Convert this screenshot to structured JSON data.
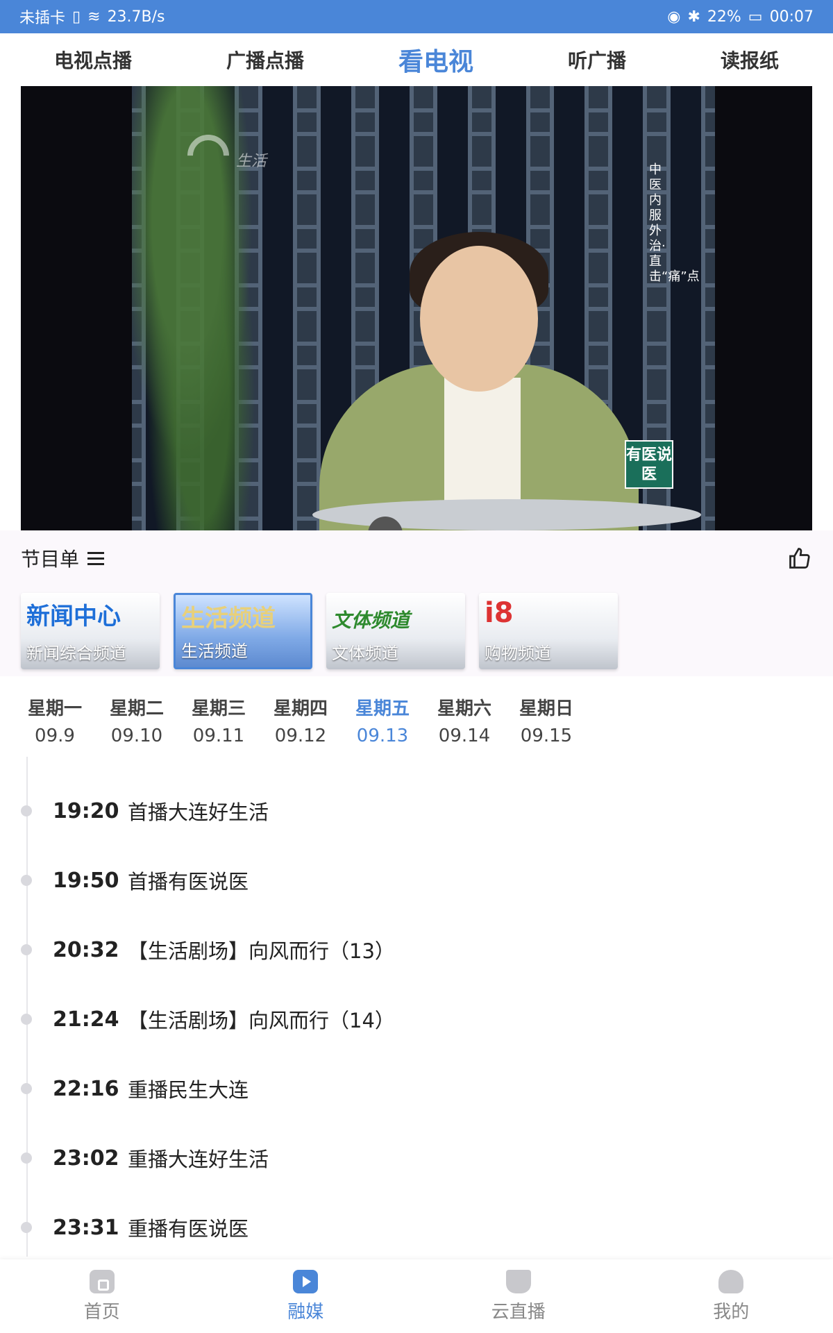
{
  "status_bar": {
    "carrier": "未插卡",
    "net_speed": "23.7B/s",
    "battery": "22%",
    "time": "00:07"
  },
  "top_tabs": [
    {
      "label": "电视点播",
      "active": false
    },
    {
      "label": "广播点播",
      "active": false
    },
    {
      "label": "看电视",
      "active": true
    },
    {
      "label": "听广播",
      "active": false
    },
    {
      "label": "读报纸",
      "active": false
    }
  ],
  "video": {
    "watermark": "生活",
    "vertical_caption": "中医内服外治·直击“痛”点",
    "program_logo": "有医说医"
  },
  "schedule": {
    "title": "节目单"
  },
  "channels": [
    {
      "name": "新闻综合频道",
      "logo_text": "新闻中心",
      "active": false
    },
    {
      "name": "生活频道",
      "logo_text": "生活频道",
      "active": true
    },
    {
      "name": "文体频道",
      "logo_text": "文体频道",
      "active": false
    },
    {
      "name": "购物频道",
      "logo_text": "i8",
      "active": false
    }
  ],
  "days": [
    {
      "name": "星期一",
      "date": "09.9",
      "active": false
    },
    {
      "name": "星期二",
      "date": "09.10",
      "active": false
    },
    {
      "name": "星期三",
      "date": "09.11",
      "active": false
    },
    {
      "name": "星期四",
      "date": "09.12",
      "active": false
    },
    {
      "name": "星期五",
      "date": "09.13",
      "active": true
    },
    {
      "name": "星期六",
      "date": "09.14",
      "active": false
    },
    {
      "name": "星期日",
      "date": "09.15",
      "active": false
    }
  ],
  "programs": [
    {
      "time": "19:20",
      "title": "首播大连好生活"
    },
    {
      "time": "19:50",
      "title": "首播有医说医"
    },
    {
      "time": "20:32",
      "title": "【生活剧场】向风而行（13）"
    },
    {
      "time": "21:24",
      "title": "【生活剧场】向风而行（14）"
    },
    {
      "time": "22:16",
      "title": "重播民生大连"
    },
    {
      "time": "23:02",
      "title": "重播大连好生活"
    },
    {
      "time": "23:31",
      "title": "重播有医说医"
    }
  ],
  "bottom_nav": [
    {
      "label": "首页",
      "icon": "home-icon",
      "active": false
    },
    {
      "label": "融媒",
      "icon": "play-icon",
      "active": true
    },
    {
      "label": "云直播",
      "icon": "cup-icon",
      "active": false
    },
    {
      "label": "我的",
      "icon": "user-icon",
      "active": false
    }
  ],
  "colors": {
    "accent": "#4a86d8",
    "status_bar": "#4a86d8"
  }
}
